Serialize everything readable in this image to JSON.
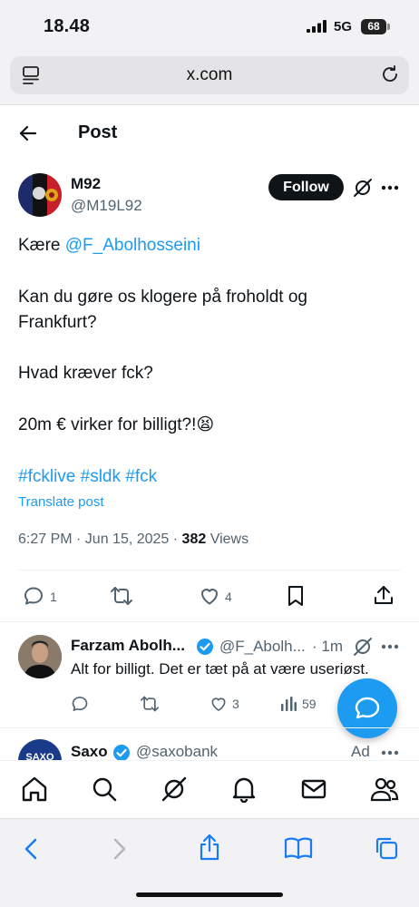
{
  "status_bar": {
    "time": "18.48",
    "network": "5G",
    "battery": "68"
  },
  "browser": {
    "url": "x.com"
  },
  "header": {
    "title": "Post"
  },
  "post": {
    "author_name": "M92",
    "author_handle": "@M19L92",
    "follow_label": "Follow",
    "greeting": "Kære ",
    "mention": "@F_Abolhosseini",
    "line1": "Kan du gøre os klogere på froholdt og",
    "line2": "Frankfurt?",
    "line3": "Hvad kræver fck?",
    "line4": "20m € virker for billigt?!😫",
    "hashtags": "#fcklive #sldk #fck",
    "translate_label": "Translate post",
    "timestamp": "6:27 PM · Jun 15, 2025 · ",
    "views_count": "382",
    "views_label": " Views",
    "replies": "1",
    "likes": "4"
  },
  "reply": {
    "name": "Farzam Abolh...",
    "handle": "@F_Abolh...",
    "time": "· 1m",
    "text": "Alt for billigt. Det er tæt på at være useriøst.",
    "likes": "3",
    "views": "59"
  },
  "ad": {
    "name": "Saxo",
    "handle": "@saxobank",
    "label": "Ad",
    "avatar_text": "SAXO"
  },
  "colors": {
    "accent": "#1d9bf0",
    "text": "#0f1419",
    "muted": "#536471"
  }
}
